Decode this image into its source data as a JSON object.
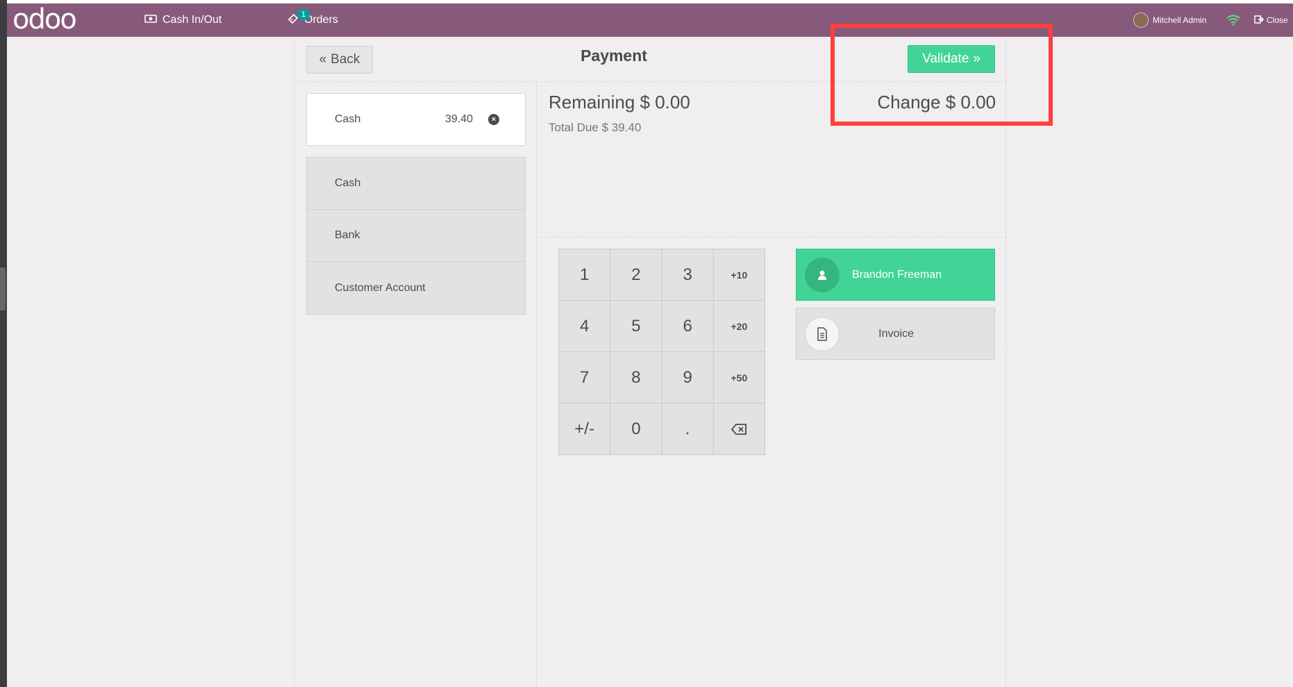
{
  "navbar": {
    "logo": "odoo",
    "cash_in_out": "Cash In/Out",
    "orders": "Orders",
    "orders_badge": "1",
    "user": "Mitchell Admin",
    "close": "Close"
  },
  "header": {
    "back": "Back",
    "title": "Payment",
    "validate": "Validate"
  },
  "payment_lines": [
    {
      "method": "Cash",
      "amount": "39.40"
    }
  ],
  "payment_methods": [
    "Cash",
    "Bank",
    "Customer Account"
  ],
  "summary": {
    "remaining_label": "Remaining",
    "remaining_value": "$ 0.00",
    "total_due_label": "Total Due",
    "total_due_value": "$ 39.40",
    "change_label": "Change",
    "change_value": "$ 0.00"
  },
  "numpad": {
    "k1": "1",
    "k2": "2",
    "k3": "3",
    "p10": "+10",
    "k4": "4",
    "k5": "5",
    "k6": "6",
    "p20": "+20",
    "k7": "7",
    "k8": "8",
    "k9": "9",
    "p50": "+50",
    "sign": "+/-",
    "k0": "0",
    "dot": "."
  },
  "customer": {
    "name": "Brandon Freeman"
  },
  "invoice": {
    "label": "Invoice"
  },
  "colors": {
    "navbar": "#875a7b",
    "accent_green": "#41d496",
    "highlight": "#ff3e3e",
    "badge": "#00a09d"
  }
}
